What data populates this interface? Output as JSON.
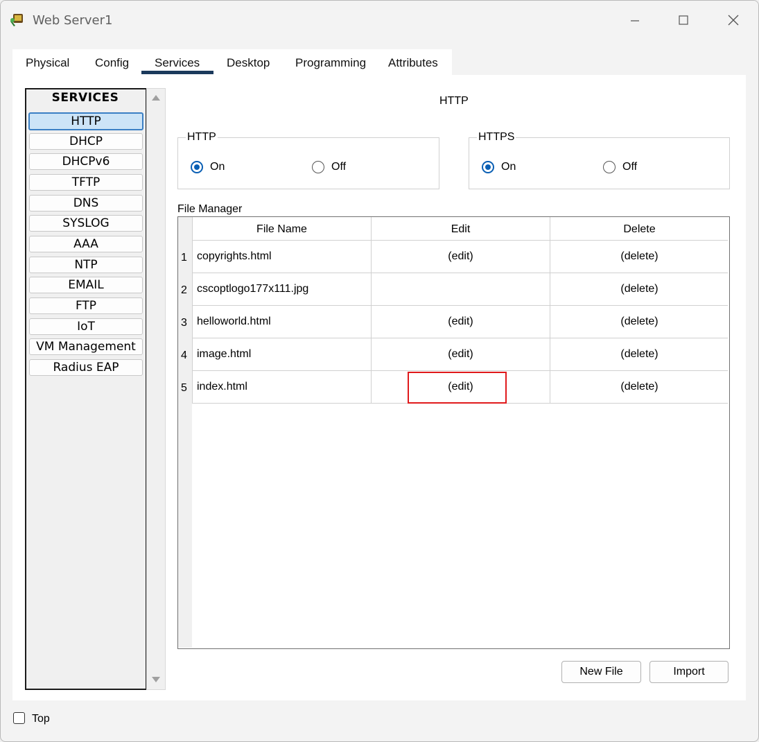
{
  "window": {
    "title": "Web Server1"
  },
  "tabs": [
    "Physical",
    "Config",
    "Services",
    "Desktop",
    "Programming",
    "Attributes"
  ],
  "active_tab": "Services",
  "services": {
    "header": "SERVICES",
    "items": [
      "HTTP",
      "DHCP",
      "DHCPv6",
      "TFTP",
      "DNS",
      "SYSLOG",
      "AAA",
      "NTP",
      "EMAIL",
      "FTP",
      "IoT",
      "VM Management",
      "Radius EAP"
    ],
    "selected": "HTTP"
  },
  "main": {
    "title": "HTTP",
    "http_group": {
      "label": "HTTP",
      "on_label": "On",
      "off_label": "Off",
      "selected": "On"
    },
    "https_group": {
      "label": "HTTPS",
      "on_label": "On",
      "off_label": "Off",
      "selected": "On"
    },
    "file_manager": {
      "label": "File Manager",
      "columns": [
        "File Name",
        "Edit",
        "Delete"
      ],
      "rows": [
        {
          "num": "1",
          "name": "copyrights.html",
          "edit": "(edit)",
          "delete": "(delete)"
        },
        {
          "num": "2",
          "name": "cscoptlogo177x111.jpg",
          "edit": "",
          "delete": "(delete)"
        },
        {
          "num": "3",
          "name": "helloworld.html",
          "edit": "(edit)",
          "delete": "(delete)"
        },
        {
          "num": "4",
          "name": "image.html",
          "edit": "(edit)",
          "delete": "(delete)"
        },
        {
          "num": "5",
          "name": "index.html",
          "edit": "(edit)",
          "delete": "(delete)"
        }
      ]
    },
    "new_file_label": "New File",
    "import_label": "Import"
  },
  "footer": {
    "top_label": "Top",
    "top_checked": false
  },
  "colors": {
    "highlight": "#e0191b",
    "radio_selected": "#0a5fb4",
    "tab_underline": "#1b3a5c"
  }
}
